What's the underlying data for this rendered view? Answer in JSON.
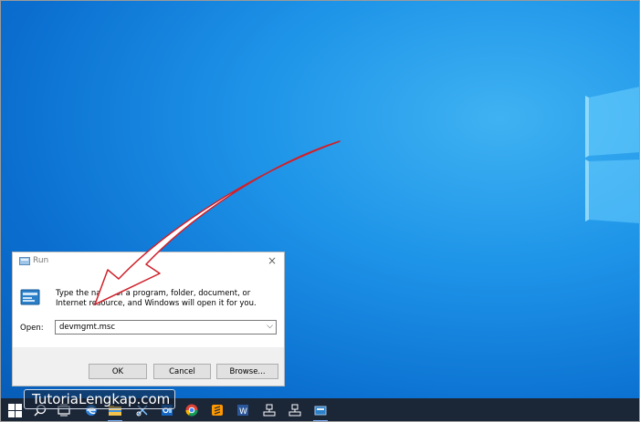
{
  "run_dialog": {
    "title": "Run",
    "close_glyph": "×",
    "description": "Type the name of a program, folder, document, or Internet resource, and Windows will open it for you.",
    "open_label": "Open:",
    "command_value": "devmgmt.msc",
    "buttons": {
      "ok": "OK",
      "cancel": "Cancel",
      "browse": "Browse..."
    }
  },
  "watermark": "TutoriaLengkap.com",
  "taskbar": {
    "icons": [
      "windows-start-icon",
      "search-icon",
      "task-view-icon",
      "edge-icon",
      "file-explorer-icon",
      "snipping-tool-icon",
      "outlook-icon",
      "chrome-icon",
      "sublime-text-icon",
      "word-icon",
      "network-icon",
      "network-icon",
      "run-icon"
    ]
  },
  "colors": {
    "desktop": "#1e94e8",
    "taskbar": "#1b2637",
    "arrow_outline": "#d0202a"
  }
}
